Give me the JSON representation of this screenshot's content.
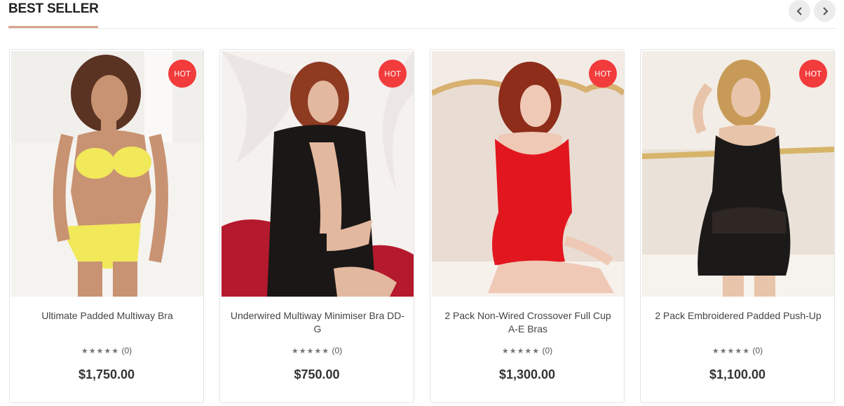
{
  "section": {
    "title": "BEST SELLER"
  },
  "colors": {
    "accent_underline": "#d9a48e",
    "hot_badge": "#f23b3b"
  },
  "nav": {
    "prev_icon": "chevron-left-icon",
    "next_icon": "chevron-right-icon"
  },
  "products": [
    {
      "badge": "HOT",
      "name": "Ultimate Padded Multiway Bra",
      "stars": "★★★★★",
      "reviews": "(0)",
      "price": "$1,750.00",
      "image_palette": {
        "bg": "#f1efec",
        "garment": "#f1e85a",
        "skin": "#c89372",
        "hair": "#5b3323"
      }
    },
    {
      "badge": "HOT",
      "name": "Underwired Multiway Minimiser Bra DD-G",
      "stars": "★★★★★",
      "reviews": "(0)",
      "price": "$750.00",
      "image_palette": {
        "bg": "#f4f1ef",
        "garment": "#1b1716",
        "skin": "#e2b89f",
        "hair": "#8e3b22",
        "accent": "#b5192d"
      }
    },
    {
      "badge": "HOT",
      "name": "2 Pack Non-Wired Crossover Full Cup A-E Bras",
      "stars": "★★★★★",
      "reviews": "(0)",
      "price": "$1,300.00",
      "image_palette": {
        "bg": "#f3ece6",
        "garment": "#e2161e",
        "skin": "#efc9b6",
        "hair": "#8d2d1a",
        "accent": "#d8b070"
      }
    },
    {
      "badge": "HOT",
      "name": "2 Pack Embroidered Padded Push-Up",
      "stars": "★★★★★",
      "reviews": "(0)",
      "price": "$1,100.00",
      "image_palette": {
        "bg": "#f2ede6",
        "garment": "#1c1a19",
        "skin": "#e8c4aa",
        "hair": "#c89a57",
        "accent": "#d6b46a"
      }
    }
  ]
}
